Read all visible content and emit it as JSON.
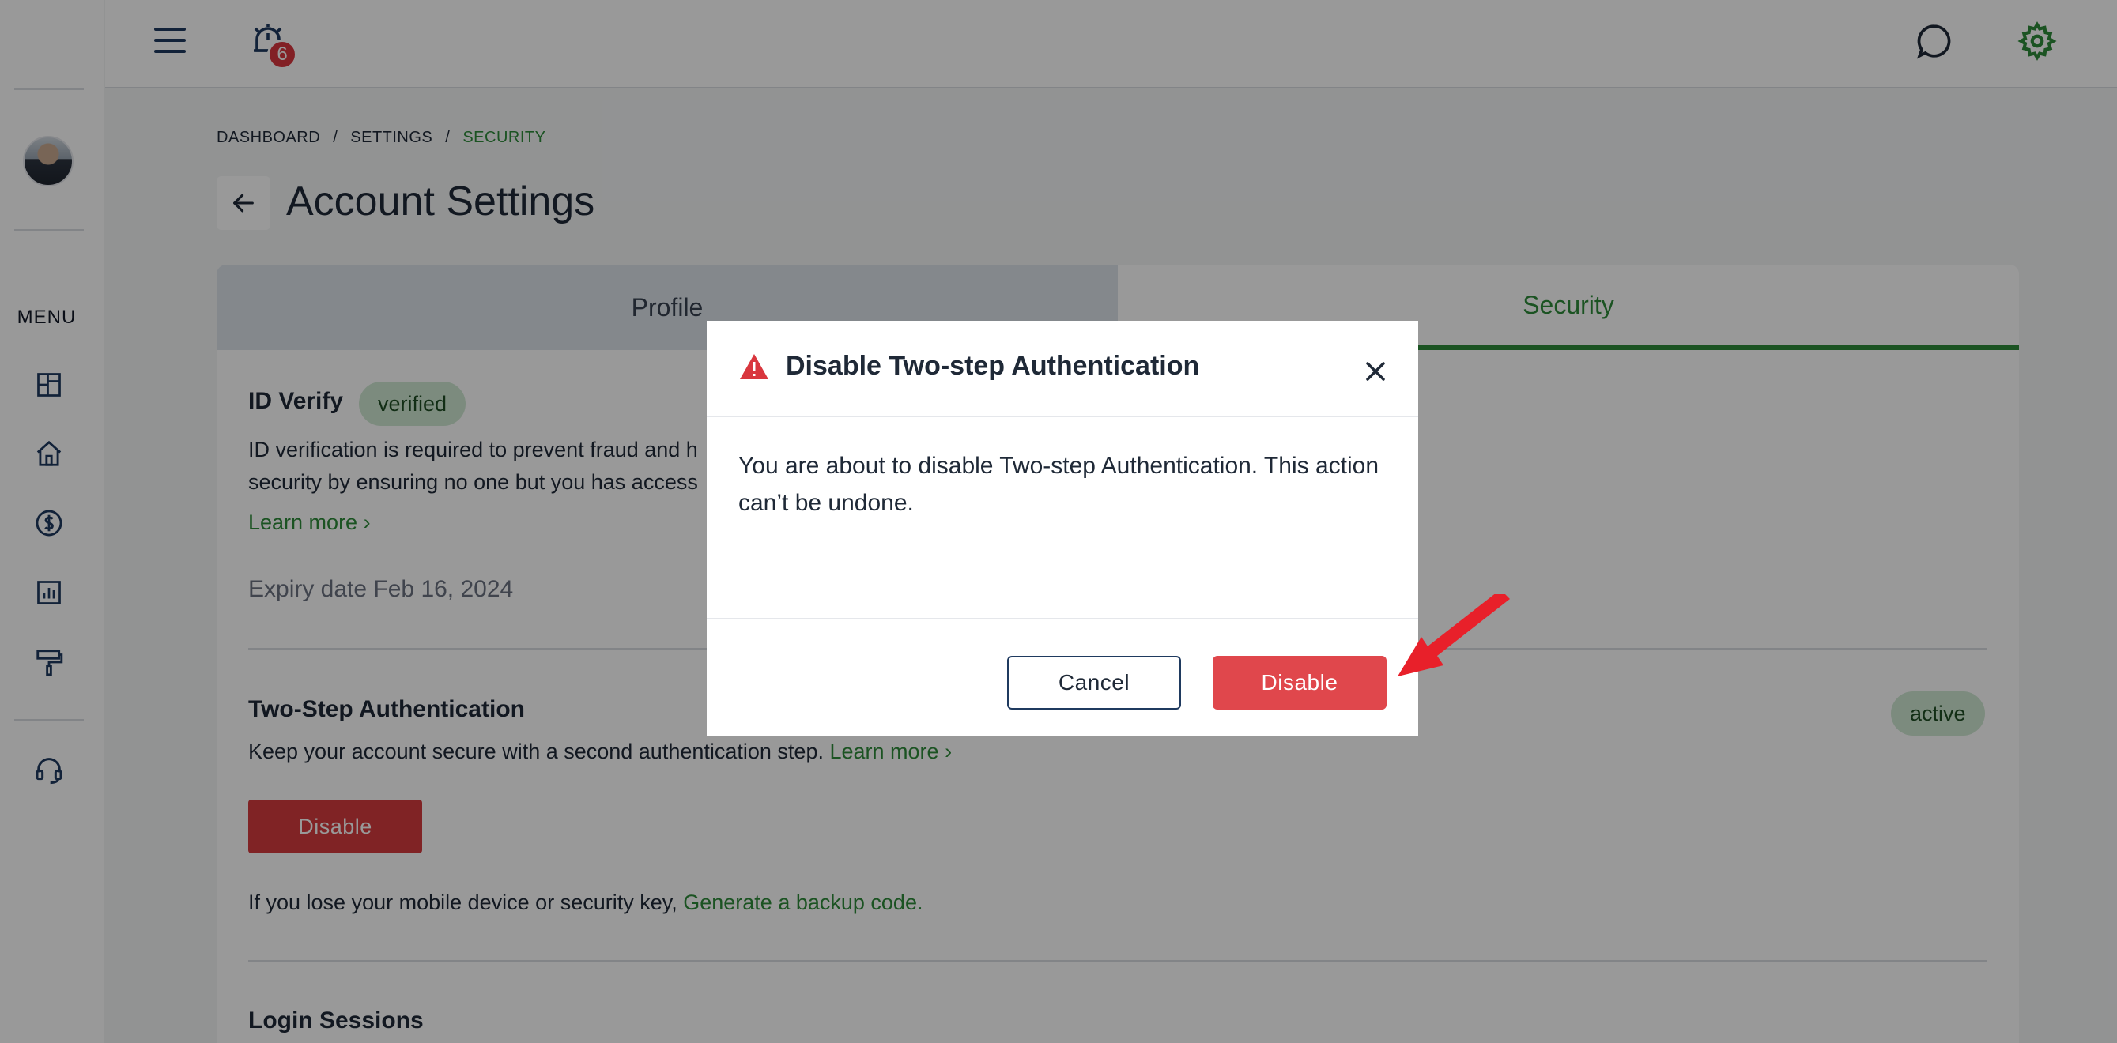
{
  "topbar": {
    "menu_icon": "hamburger-icon",
    "notification_icon": "alarm-clock-icon",
    "notification_count": "6",
    "chat_icon": "chat-bubble-icon",
    "settings_icon": "gear-icon"
  },
  "sidebar": {
    "menu_label": "MENU",
    "items": [
      {
        "icon": "dashboard-icon"
      },
      {
        "icon": "home-icon"
      },
      {
        "icon": "dollar-icon"
      },
      {
        "icon": "chart-icon"
      },
      {
        "icon": "paint-roller-icon"
      },
      {
        "icon": "headset-icon"
      }
    ]
  },
  "breadcrumb": {
    "items": [
      "DASHBOARD",
      "SETTINGS",
      "SECURITY"
    ],
    "separator": "/"
  },
  "page": {
    "title": "Account Settings"
  },
  "tabs": [
    {
      "label": "Profile",
      "selected": false
    },
    {
      "label": "Security",
      "selected": true
    }
  ],
  "id_verify": {
    "title": "ID Verify",
    "badge": "verified",
    "description_line1": "ID verification is required to prevent fraud and h",
    "description_line2": "security by ensuring no one but you has access",
    "learn_more": "Learn more",
    "expiry": "Expiry date Feb 16, 2024"
  },
  "two_step": {
    "title": "Two-Step Authentication",
    "badge": "active",
    "description": "Keep your account secure with a second authentication step.",
    "learn_more": "Learn more",
    "disable_label": "Disable",
    "backup_text": "If you lose your mobile device or security key,",
    "backup_link": "Generate a backup code."
  },
  "login_sessions": {
    "title": "Login Sessions"
  },
  "modal": {
    "title": "Disable Two-step Authentication",
    "body": "You are about to disable Two-step Authentication. This action can’t be undone.",
    "cancel_label": "Cancel",
    "confirm_label": "Disable"
  },
  "colors": {
    "accent_green": "#2e8b3a",
    "danger_red": "#e0474c",
    "annotation_arrow": "#e8202a"
  }
}
